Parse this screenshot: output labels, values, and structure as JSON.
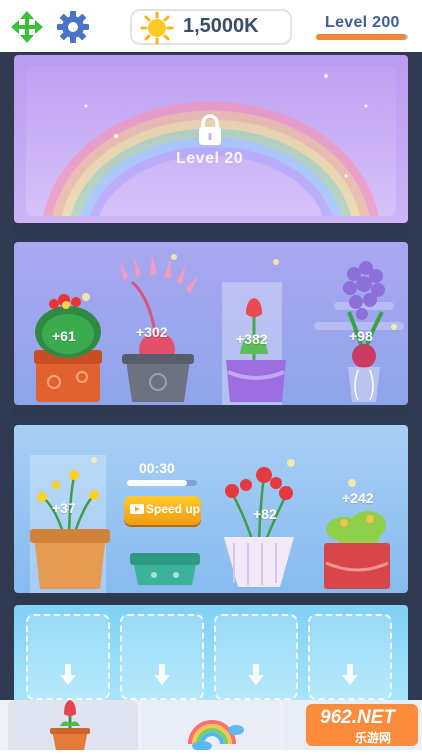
{
  "topbar": {
    "move_icon": "four-arrows-move-icon",
    "settings_icon": "gear-icon",
    "sun_icon": "sun-icon",
    "coins": "1,5000K",
    "level_label": "Level  200",
    "level_progress": 0.98
  },
  "shelves": {
    "locked": {
      "lock_icon": "padlock-icon",
      "level": "Level  20",
      "background": "rainbow"
    },
    "row2": [
      {
        "name": "cactus",
        "bonus": "+61"
      },
      {
        "name": "pink-flower",
        "bonus": "+302"
      },
      {
        "name": "tulip",
        "bonus": "+382"
      },
      {
        "name": "hyacinth",
        "bonus": "+98"
      }
    ],
    "row3": [
      {
        "name": "yellow-flowers",
        "bonus": "+37"
      },
      {
        "name": "growing-pot",
        "timer": "00:30",
        "timer_progress": 0.85,
        "button": "Speed up"
      },
      {
        "name": "red-roses",
        "bonus": "+82"
      },
      {
        "name": "succulents",
        "bonus": "+242"
      }
    ],
    "row4": {
      "empty_slots": 4,
      "slot_icon": "down-arrow-icon"
    }
  },
  "bottom_nav": {
    "tabs": [
      {
        "icon": "potted-flower-icon"
      },
      {
        "icon": "rainbow-cloud-icon"
      },
      {
        "icon": ""
      }
    ]
  },
  "watermark": {
    "text": "962.NET",
    "sub": "乐游网"
  },
  "colors": {
    "frame": "#303b52",
    "accent": "#f0883a",
    "speed_button": "#f6a81b"
  }
}
